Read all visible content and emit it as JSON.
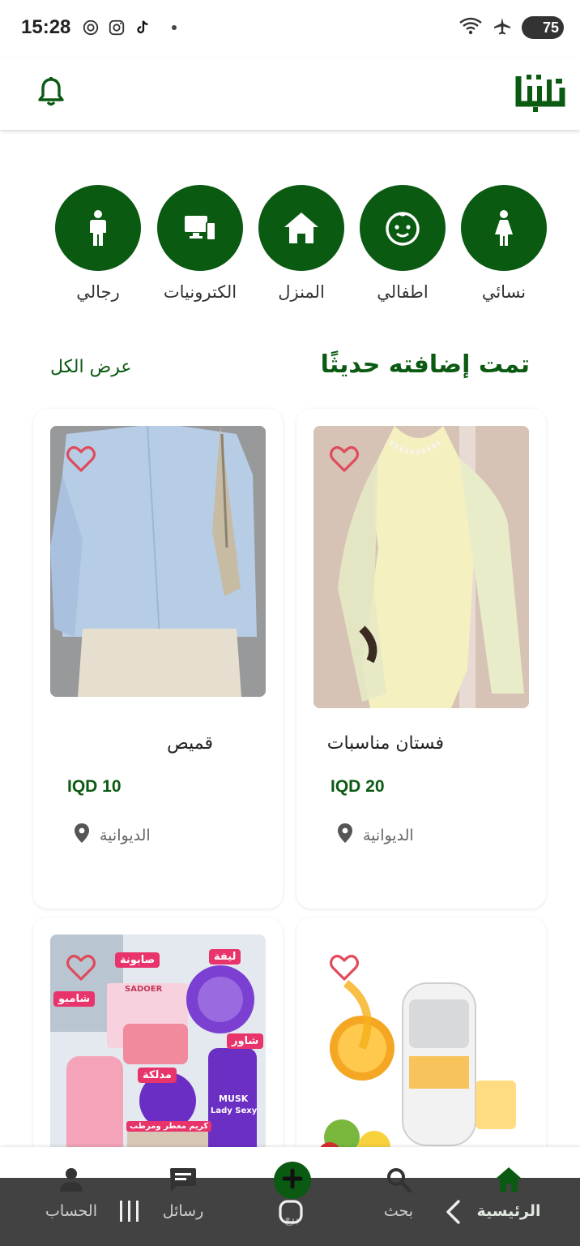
{
  "status_bar": {
    "time": "15:28",
    "battery": "75"
  },
  "header": {
    "logo_icon": "brand-logo",
    "bell_icon": "bell-icon"
  },
  "categories": [
    {
      "label": "نسائي",
      "icon": "woman-icon"
    },
    {
      "label": "اطفالي",
      "icon": "baby-face-icon"
    },
    {
      "label": "المنزل",
      "icon": "house-icon"
    },
    {
      "label": "الكترونيات",
      "icon": "devices-icon"
    },
    {
      "label": "رجالي",
      "icon": "man-icon"
    }
  ],
  "recent": {
    "title": "تمت إضافته حديثًا",
    "view_all": "عرض الكل"
  },
  "products": [
    {
      "title": "فستان مناسبات",
      "price": "IQD 20",
      "location": "الديوانية"
    },
    {
      "title": "قميص",
      "price": "IQD 10",
      "location": "الديوانية"
    },
    {
      "title": "",
      "price": "",
      "location": ""
    },
    {
      "title": "",
      "price": "",
      "location": ""
    }
  ],
  "product_images": {
    "p3_labels": [
      "صابونة",
      "ليفة",
      "شامبو",
      "شاور",
      "مدلكة",
      "كريم معطر ومرطب",
      "SADOER",
      "MUSK",
      "Lady Sexy"
    ]
  },
  "bottom_nav": {
    "items": [
      {
        "label": "الرئيسية",
        "icon": "home-icon",
        "active": true
      },
      {
        "label": "بحث",
        "icon": "search-icon"
      },
      {
        "label": "بيع",
        "icon": "add-icon"
      },
      {
        "label": "رسائل",
        "icon": "chat-icon"
      },
      {
        "label": "الحساب",
        "icon": "person-icon"
      }
    ]
  },
  "colors": {
    "brand_green": "#0b5a12",
    "heart_red": "#e04a5a"
  }
}
